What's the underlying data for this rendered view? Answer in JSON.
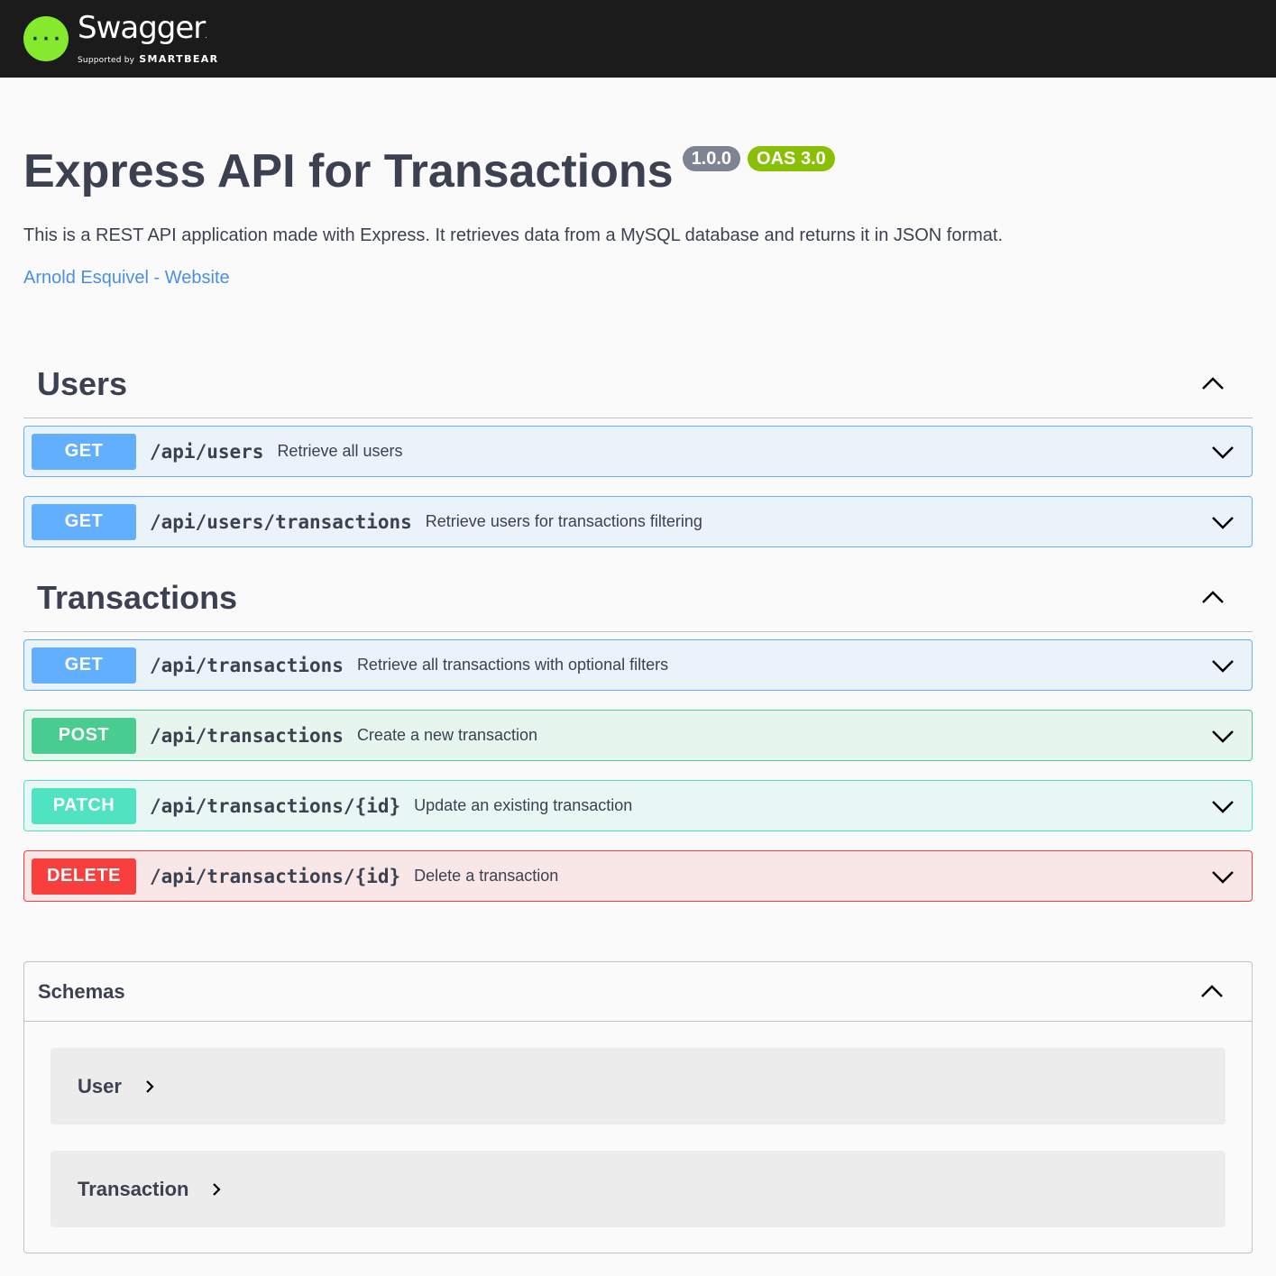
{
  "topbar": {
    "logo_name": "Swagger",
    "logo_tm": ".",
    "logo_sub": "Supported by",
    "logo_brand": "SMARTBEAR",
    "logo_color": "#85ea2d"
  },
  "info": {
    "title": "Express API for Transactions",
    "version": "1.0.0",
    "oas": "OAS 3.0",
    "description": "This is a REST API application made with Express. It retrieves data from a MySQL database and returns it in JSON format.",
    "contact_link": "Arnold Esquivel - Website"
  },
  "tags": [
    {
      "name": "Users",
      "operations": [
        {
          "method": "GET",
          "path": "/api/users",
          "summary": "Retrieve all users"
        },
        {
          "method": "GET",
          "path": "/api/users/transactions",
          "summary": "Retrieve users for transactions filtering"
        }
      ]
    },
    {
      "name": "Transactions",
      "operations": [
        {
          "method": "GET",
          "path": "/api/transactions",
          "summary": "Retrieve all transactions with optional filters"
        },
        {
          "method": "POST",
          "path": "/api/transactions",
          "summary": "Create a new transaction"
        },
        {
          "method": "PATCH",
          "path": "/api/transactions/{id}",
          "summary": "Update an existing transaction"
        },
        {
          "method": "DELETE",
          "path": "/api/transactions/{id}",
          "summary": "Delete a transaction"
        }
      ]
    }
  ],
  "schemas": {
    "title": "Schemas",
    "models": [
      "User",
      "Transaction"
    ]
  },
  "colors": {
    "get": "#61affe",
    "post": "#49cc90",
    "patch": "#50e3c2",
    "delete": "#f93e3e"
  }
}
